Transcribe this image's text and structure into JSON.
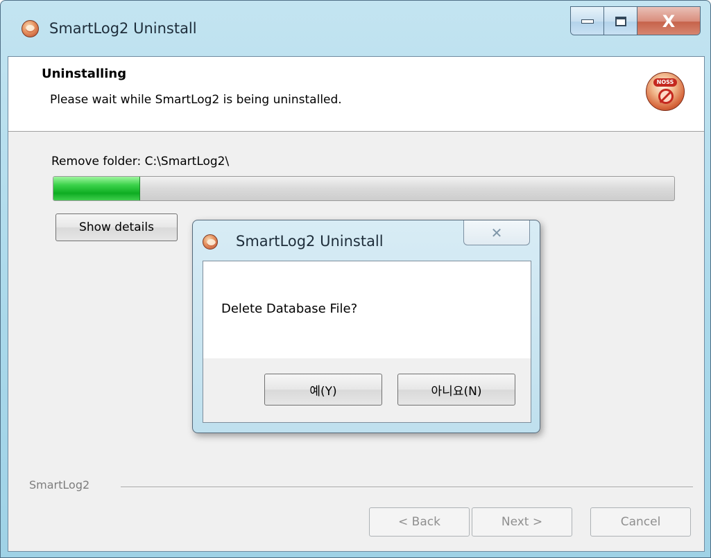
{
  "window": {
    "title": "SmartLog2 Uninstall",
    "icons": {
      "app": "smartlog2-app-icon",
      "minimize": "minimize-icon",
      "maximize": "maximize-icon",
      "close": "close-icon"
    },
    "close_glyph": "X"
  },
  "header": {
    "title": "Uninstalling",
    "subtitle": "Please wait while SmartLog2 is being uninstalled.",
    "logo_badge": "NOSS",
    "logo_icon": "uninstall-logo-icon"
  },
  "progress": {
    "status": "Remove folder: C:\\SmartLog2\\",
    "fraction": 0.14,
    "fill_color": "#22c43a"
  },
  "buttons": {
    "show_details": "Show details",
    "back": "< Back",
    "next": "Next >",
    "cancel": "Cancel"
  },
  "footer": {
    "brand": "SmartLog2"
  },
  "dialog": {
    "title": "SmartLog2 Uninstall",
    "close_glyph": "✕",
    "message": "Delete Database File?",
    "yes_label": "예(Y)",
    "no_label": "아니요(N)"
  }
}
